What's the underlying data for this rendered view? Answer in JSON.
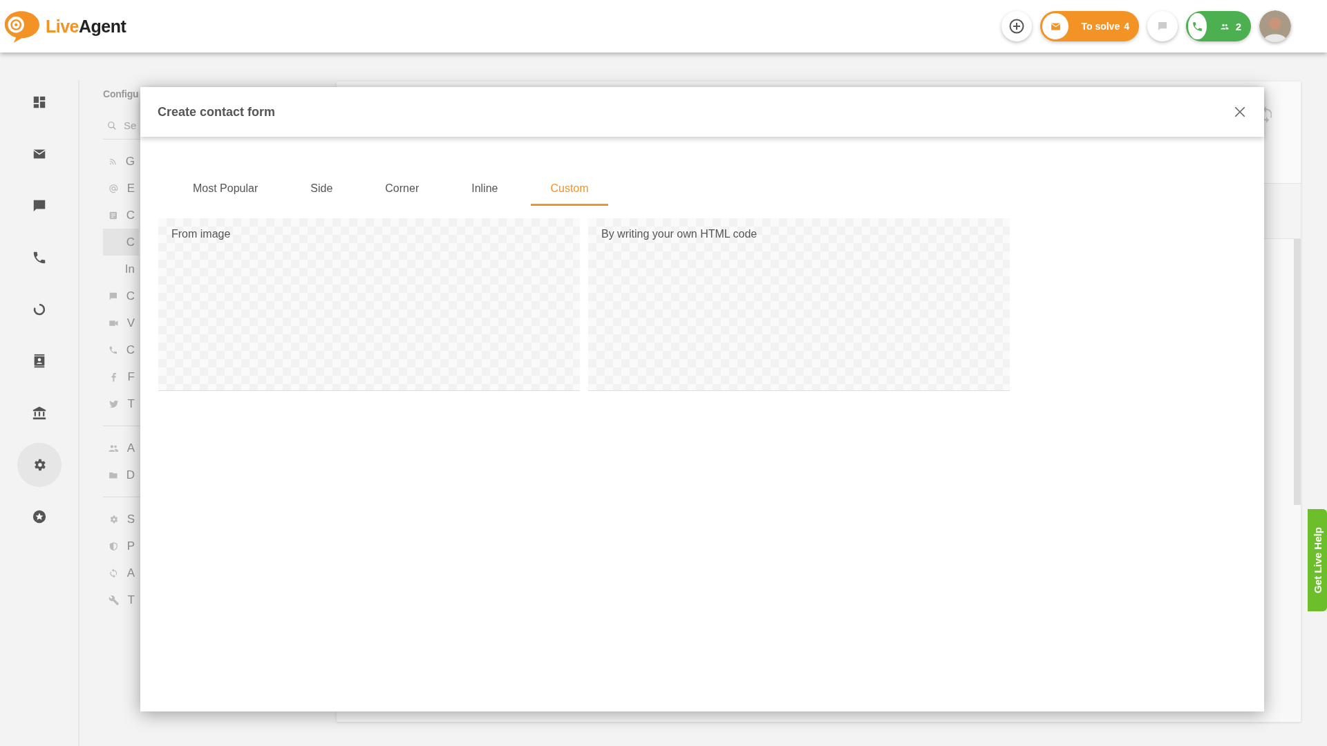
{
  "header": {
    "logo": {
      "part_1": "Live",
      "part_2": "Agent"
    },
    "to_solve": {
      "label": "To solve",
      "count": "4"
    },
    "calls": {
      "count": "2"
    }
  },
  "nav_rail": {
    "items": [
      {
        "kind": "dashboard",
        "selected": false
      },
      {
        "kind": "mail",
        "selected": false
      },
      {
        "kind": "chat",
        "selected": false
      },
      {
        "kind": "phone",
        "selected": false
      },
      {
        "kind": "circle",
        "selected": false
      },
      {
        "kind": "contacts",
        "selected": false
      },
      {
        "kind": "bank",
        "selected": false
      },
      {
        "kind": "settings",
        "selected": true
      },
      {
        "kind": "star",
        "selected": false
      }
    ]
  },
  "config_panel": {
    "title": "Configu",
    "search": {
      "placeholder": "Se"
    },
    "groups": [
      {
        "items": [
          {
            "kind": "rss",
            "label": "G",
            "selected": false
          },
          {
            "kind": "at",
            "label": "E",
            "selected": false
          },
          {
            "kind": "form",
            "label": "C",
            "selected": false
          },
          {
            "kind": "none",
            "label": "C",
            "selected": true
          },
          {
            "kind": "none",
            "label": "In",
            "selected": false
          },
          {
            "kind": "chat",
            "label": "C",
            "selected": false
          },
          {
            "kind": "video",
            "label": "V",
            "selected": false
          },
          {
            "kind": "phone",
            "label": "C",
            "selected": false
          },
          {
            "kind": "facebook",
            "label": "F",
            "selected": false
          },
          {
            "kind": "bird",
            "label": "T",
            "selected": false
          }
        ]
      },
      {
        "items": [
          {
            "kind": "people",
            "label": "A",
            "selected": false
          },
          {
            "kind": "folder",
            "label": "D",
            "selected": false
          }
        ]
      },
      {
        "items": [
          {
            "kind": "gear",
            "label": "S",
            "selected": false
          },
          {
            "kind": "shield",
            "label": "P",
            "selected": false
          },
          {
            "kind": "sync",
            "label": "A",
            "selected": false
          },
          {
            "kind": "wrench",
            "label": "T",
            "selected": false
          }
        ]
      }
    ]
  },
  "modal": {
    "title": "Create contact form",
    "tabs": [
      {
        "label": "Most Popular",
        "selected": false
      },
      {
        "label": "Side",
        "selected": false
      },
      {
        "label": "Corner",
        "selected": false
      },
      {
        "label": "Inline",
        "selected": false
      },
      {
        "label": "Custom",
        "selected": true
      }
    ],
    "options": [
      {
        "label": "From image"
      },
      {
        "label": "By writing your own HTML code"
      }
    ]
  },
  "live_help": {
    "label": "Get Live Help"
  }
}
